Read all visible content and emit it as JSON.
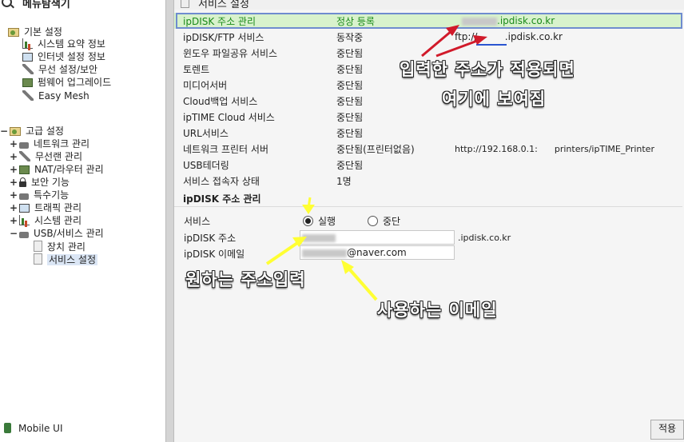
{
  "left": {
    "header": "메뉴탐색기",
    "basic_settings": "기본 설정",
    "basic_items": [
      "시스템 요약 정보",
      "인터넷 설정 정보",
      "무선 설정/보안",
      "펌웨어 업그레이드",
      "Easy Mesh"
    ],
    "advanced_settings": "고급 설정",
    "advanced_items": [
      "네트워크 관리",
      "무선랜 관리",
      "NAT/라우터 관리",
      "보안 기능",
      "특수기능",
      "트래픽 관리",
      "시스템 관리",
      "USB/서비스 관리"
    ],
    "usb_children": [
      "장치 관리",
      "서비스 설정"
    ],
    "expand_plus": "+",
    "expand_minus": "−",
    "mobile_ui": "Mobile UI"
  },
  "right": {
    "title": "서비스 설정",
    "services": [
      {
        "name": "ipDISK 주소 관리",
        "status": "정상 등록",
        "extra": ".ipdisk.co.kr"
      },
      {
        "name": "ipDISK/FTP 서비스",
        "status": "동작중",
        "extra": "ftp://         .ipdisk.co.kr"
      },
      {
        "name": "윈도우 파일공유 서비스",
        "status": "중단됨",
        "extra": ""
      },
      {
        "name": "토렌트",
        "status": "중단됨",
        "extra": ""
      },
      {
        "name": "미디어서버",
        "status": "중단됨",
        "extra": ""
      },
      {
        "name": "Cloud백업 서비스",
        "status": "중단됨",
        "extra": ""
      },
      {
        "name": "ipTIME Cloud 서비스",
        "status": "중단됨",
        "extra": ""
      },
      {
        "name": "URL서비스",
        "status": "중단됨",
        "extra": ""
      },
      {
        "name": "네트워크 프린터 서버",
        "status": "중단됨(프린터없음)",
        "extra": "http://192.168.0.1:      printers/ipTIME_Printer"
      },
      {
        "name": "USB테더링",
        "status": "중단됨",
        "extra": ""
      },
      {
        "name": "서비스 접속자 상태",
        "status": "1명",
        "extra": ""
      }
    ],
    "section_title": "ipDISK 주소 관리",
    "service_label": "서비스",
    "radio_run": "실행",
    "radio_stop": "중단",
    "address_label": "ipDISK 주소",
    "address_suffix": ".ipdisk.co.kr",
    "email_label": "ipDISK 이메일",
    "email_value": "@naver.com",
    "apply_button": "적용"
  },
  "annotations": {
    "top_line1": "입력한 주소가 적용되면",
    "top_line2": "여기에 보여짐",
    "address_note": "원하는 주소입력",
    "email_note": "사용하는 이메일"
  },
  "colors": {
    "highlight_row": "#d8f2cc",
    "highlight_border": "#6f8ccf",
    "arrow_red": "#d11a2a",
    "arrow_yellow": "#ffff33"
  }
}
